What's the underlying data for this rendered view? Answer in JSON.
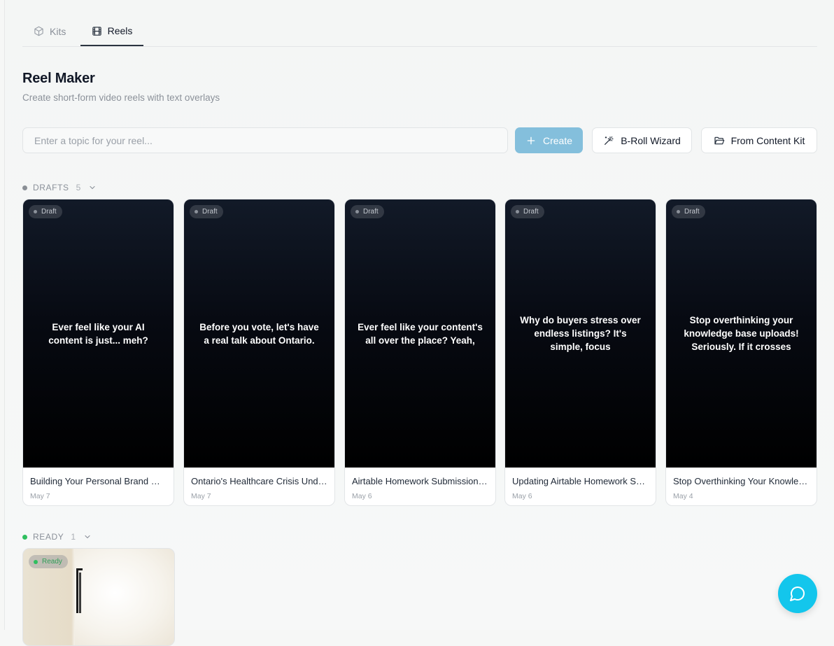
{
  "tabs": [
    {
      "label": "Kits",
      "icon": "box-icon",
      "active": false
    },
    {
      "label": "Reels",
      "icon": "film-icon",
      "active": true
    }
  ],
  "header": {
    "title": "Reel Maker",
    "subtitle": "Create short-form video reels with text overlays"
  },
  "controls": {
    "topic_placeholder": "Enter a topic for your reel...",
    "topic_value": "",
    "create_label": "Create",
    "broll_label": "B-Roll Wizard",
    "content_kit_label": "From Content Kit"
  },
  "sections": {
    "drafts": {
      "label": "DRAFTS",
      "count": "5",
      "dot_color": "#8a8f96"
    },
    "ready": {
      "label": "READY",
      "count": "1",
      "dot_color": "#2fbf5f"
    }
  },
  "drafts": [
    {
      "badge": "Draft",
      "overlay": "Ever feel like your AI content is just... meh?",
      "title": "Building Your Personal Brand with AI Content",
      "date": "May 7"
    },
    {
      "badge": "Draft",
      "overlay": "Before you vote, let's have a real talk about Ontario.",
      "title": "Ontario's Healthcare Crisis Under Review",
      "date": "May 7"
    },
    {
      "badge": "Draft",
      "overlay": "Ever feel like your content's all over the place? Yeah,",
      "title": "Airtable Homework Submission Workflow",
      "date": "May 6"
    },
    {
      "badge": "Draft",
      "overlay": "Why do buyers stress over endless listings? It's simple, focus",
      "title": "Updating Airtable Homework Submissions",
      "date": "May 6"
    },
    {
      "badge": "Draft",
      "overlay": "Stop overthinking your knowledge base uploads! Seriously. If it crosses",
      "title": "Stop Overthinking Your Knowledge Base",
      "date": "May 4"
    }
  ],
  "ready_items": [
    {
      "badge": "Ready"
    }
  ],
  "colors": {
    "accent_create": "#84bfdc",
    "chat_fab": "#13c6ec",
    "ready_green": "#2fbf5f"
  }
}
